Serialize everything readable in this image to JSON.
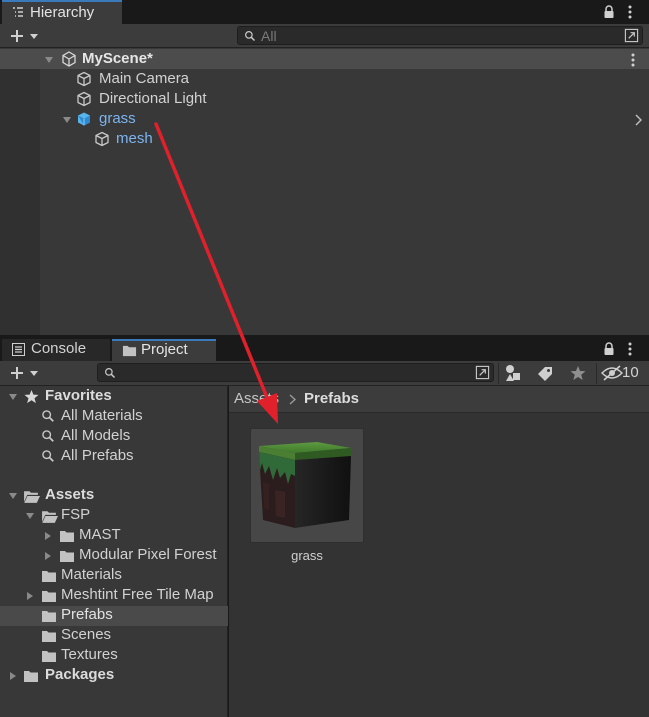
{
  "hierarchy": {
    "tab_title": "Hierarchy",
    "search_placeholder": "All",
    "scene_name": "MyScene*",
    "items": [
      {
        "label": "Main Camera",
        "prefab": false
      },
      {
        "label": "Directional Light",
        "prefab": false
      },
      {
        "label": "grass",
        "prefab": true
      },
      {
        "label": "mesh",
        "prefab": true
      }
    ]
  },
  "bottom_tabs": {
    "console": "Console",
    "project": "Project"
  },
  "project": {
    "search_placeholder": "",
    "hidden_count": "10",
    "favorites_label": "Favorites",
    "favorites": [
      "All Materials",
      "All Models",
      "All Prefabs"
    ],
    "assets_label": "Assets",
    "fsp_label": "FSP",
    "fsp_children": [
      "MAST",
      "Modular Pixel Forest"
    ],
    "asset_folders": [
      "Materials",
      "Meshtint Free Tile Map",
      "Prefabs",
      "Scenes",
      "Textures"
    ],
    "packages_label": "Packages",
    "breadcrumb": {
      "root": "Assets",
      "current": "Prefabs"
    },
    "asset_items": [
      {
        "name": "grass"
      }
    ]
  },
  "colors": {
    "accent": "#3a79bb",
    "prefab_text": "#7cb4f0",
    "arrow": "#e0202a",
    "panel_bg": "#383838"
  }
}
